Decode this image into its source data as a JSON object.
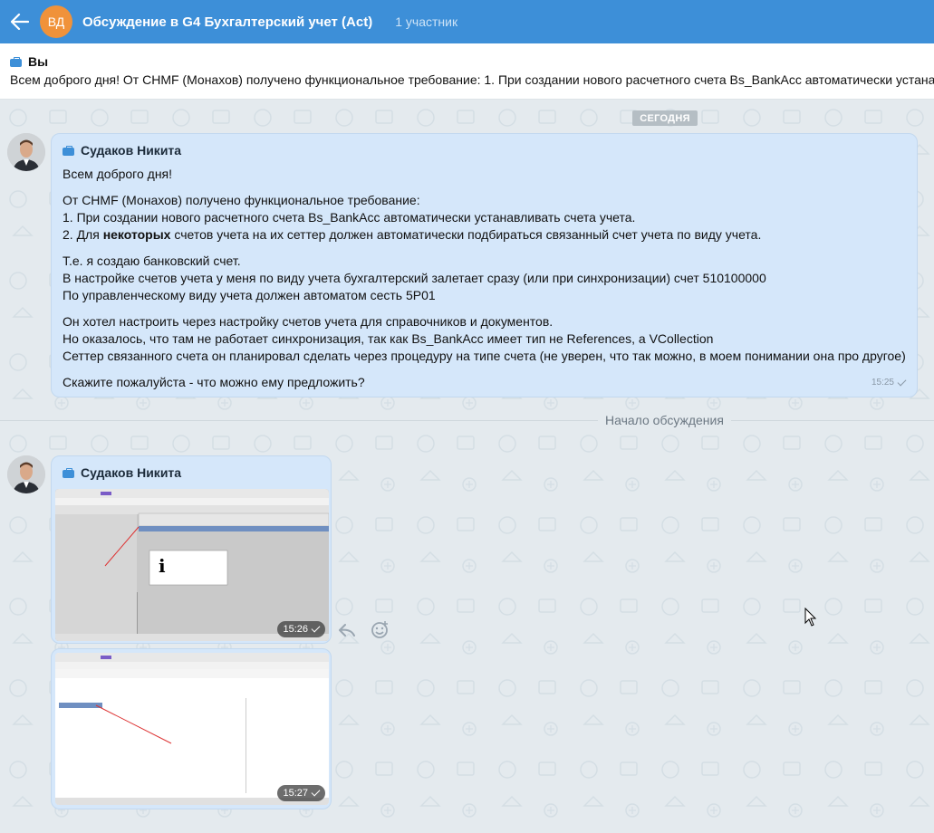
{
  "header": {
    "avatar_initials": "ВД",
    "title": "Обсуждение в G4 Бухгалтерский учет (Act)",
    "participants": "1 участник"
  },
  "pinned": {
    "author": "Вы",
    "text": "Всем доброго дня! От CHMF (Монахов) получено функциональное требование: 1. При создании нового расчетного счета Bs_BankAcc автоматически устана"
  },
  "chat": {
    "date_badge": "СЕГОДНЯ",
    "divider_label": "Начало обсуждения",
    "messages": [
      {
        "author": "Судаков Никита",
        "greeting": "Всем доброго дня!",
        "p1_l1": "От CHMF (Монахов) получено функциональное требование:",
        "p1_l2": "1. При создании нового расчетного счета Bs_BankAcc автоматически устанавливать счета учета.",
        "p1_l3_pre": "2. Для ",
        "p1_l3_bold": "некоторых",
        "p1_l3_post": " счетов учета на их сеттер должен автоматически подбираться связанный счет учета по виду учета.",
        "p2_l1": "Т.е. я создаю банковский счет.",
        "p2_l2": "В настройке счетов учета у меня по виду учета бухгалтерский залетает сразу (или при синхронизации) счет 510100000",
        "p2_l3": "По управленческому виду учета должен автоматом сесть 5Р01",
        "p3_l1": "Он хотел настроить через настройку счетов учета для справочников и документов.",
        "p3_l2": "Но оказалось, что там не работает синхронизация, так как Bs_BankAcc имеет тип не References, а VCollection",
        "p3_l3": "Сеттер связанного счета он планировал сделать через процедуру на типе счета (не уверен, что так можно, в моем понимании она про другое)",
        "p4": "Скажите пожалуйста - что можно ему предложить?",
        "time": "15:25"
      },
      {
        "author": "Судаков Никита",
        "image1_time": "15:26",
        "image2_time": "15:27"
      }
    ]
  },
  "icons": [
    "back-arrow-icon",
    "briefcase-icon",
    "reply-icon",
    "emoji-icon",
    "check-icon",
    "mouse-cursor-icon"
  ],
  "colors": {
    "header": "#3d8fd8",
    "avatar": "#f0923a",
    "bubble": "#d5e7fa"
  }
}
